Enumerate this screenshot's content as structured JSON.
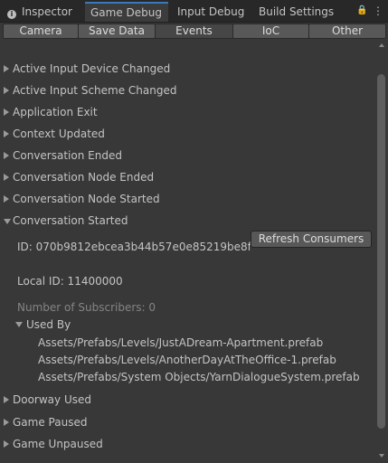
{
  "tabs": [
    {
      "label": "Inspector",
      "icon": "info-icon"
    },
    {
      "label": "Game Debug"
    },
    {
      "label": "Input Debug"
    },
    {
      "label": "Build Settings"
    }
  ],
  "tab_controls": {
    "lock": "🔒",
    "menu": "⋮"
  },
  "subtabs": [
    {
      "label": "Camera"
    },
    {
      "label": "Save Data"
    },
    {
      "label": "Events",
      "selected": true
    },
    {
      "label": "IoC"
    },
    {
      "label": "Other"
    }
  ],
  "events": [
    {
      "label": "Active Input Device Changed",
      "expanded": false
    },
    {
      "label": "Active Input Scheme Changed",
      "expanded": false
    },
    {
      "label": "Application Exit",
      "expanded": false
    },
    {
      "label": "Context Updated",
      "expanded": false
    },
    {
      "label": "Conversation Ended",
      "expanded": false
    },
    {
      "label": "Conversation Node Ended",
      "expanded": false
    },
    {
      "label": "Conversation Node Started",
      "expanded": false
    },
    {
      "label": "Conversation Started",
      "expanded": true
    },
    {
      "label": "Doorway Used",
      "expanded": false
    },
    {
      "label": "Game Paused",
      "expanded": false
    },
    {
      "label": "Game Unpaused",
      "expanded": false
    }
  ],
  "detail": {
    "id_text": "ID: 070b9812ebcea3b44b57e0e85219be8f",
    "refresh_button": "Refresh Consumers",
    "local_id_text": "Local ID: 11400000",
    "subscribers_text": "Number of Subscribers: 0",
    "used_by_label": "Used By",
    "used_by": [
      "Assets/Prefabs/Levels/JustADream-Apartment.prefab",
      "Assets/Prefabs/Levels/AnotherDayAtTheOffice-1.prefab",
      "Assets/Prefabs/System Objects/YarnDialogueSystem.prefab"
    ]
  },
  "colors": {
    "accent": "#3a79bb",
    "background": "#383838",
    "tabbar": "#282828"
  }
}
